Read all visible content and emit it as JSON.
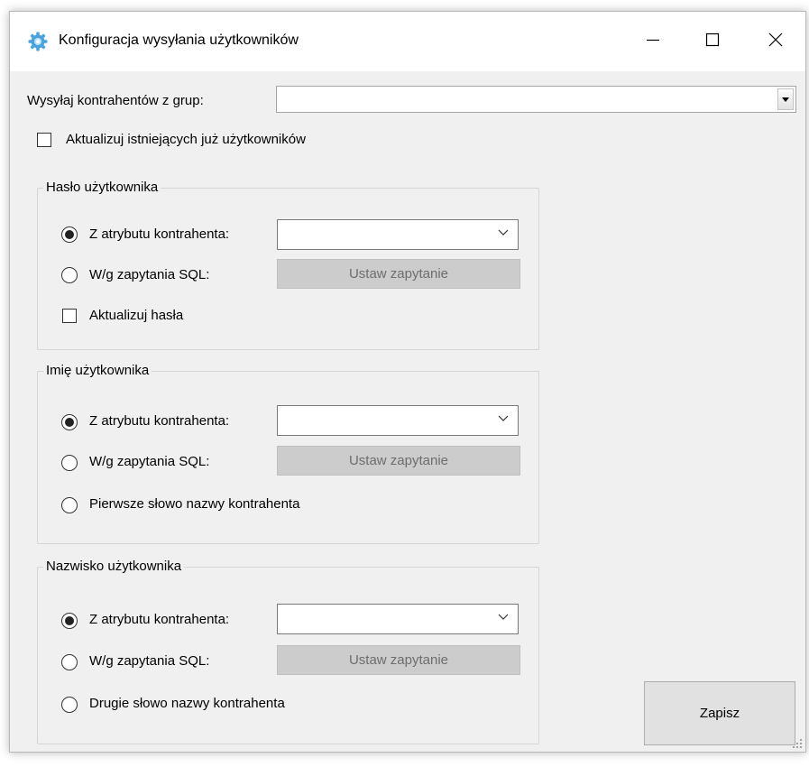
{
  "window": {
    "title": "Konfiguracja wysyłania użytkowników",
    "icon": "gear-cog-icon",
    "controls": [
      "minimize-icon",
      "maximize-icon",
      "close-icon"
    ]
  },
  "top": {
    "groups_label": "Wysyłaj kontrahentów z grup:",
    "groups_value": "",
    "update_existing_label": "Aktualizuj istniejących już użytkowników",
    "update_existing_checked": false
  },
  "password_group": {
    "title": "Hasło użytkownika",
    "option_attribute": "Z atrybutu kontrahenta:",
    "option_sql": "W/g zapytania SQL:",
    "selected": "attribute",
    "attribute_value": "",
    "sql_button": "Ustaw zapytanie",
    "update_label": "Aktualizuj hasła",
    "update_checked": false
  },
  "firstname_group": {
    "title": "Imię użytkownika",
    "option_attribute": "Z atrybutu kontrahenta:",
    "option_sql": "W/g zapytania SQL:",
    "option_word": "Pierwsze słowo nazwy kontrahenta",
    "selected": "attribute",
    "attribute_value": "",
    "sql_button": "Ustaw zapytanie"
  },
  "lastname_group": {
    "title": "Nazwisko użytkownika",
    "option_attribute": "Z atrybutu kontrahenta:",
    "option_sql": "W/g zapytania SQL:",
    "option_word": "Drugie słowo nazwy kontrahenta",
    "selected": "attribute",
    "attribute_value": "",
    "sql_button": "Ustaw zapytanie"
  },
  "actions": {
    "save_label": "Zapisz"
  },
  "colors": {
    "window_bg": "#f0f0f0",
    "titlebar_bg": "#ffffff",
    "disabled_button_bg": "#cccccc",
    "icon_blue": "#4aa3df"
  }
}
